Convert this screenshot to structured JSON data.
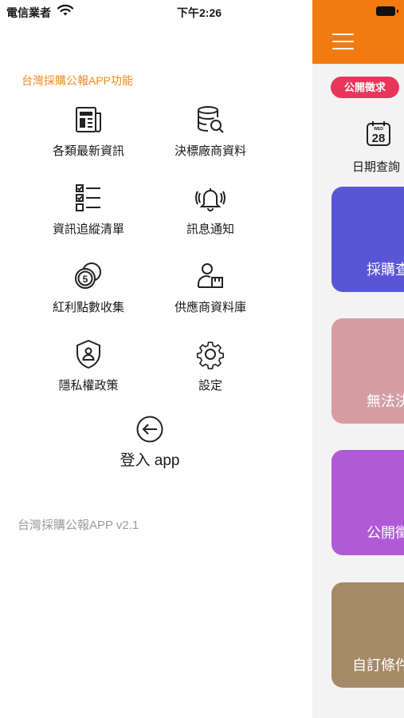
{
  "status_bar": {
    "carrier": "電信業者",
    "time": "下午2:26"
  },
  "drawer": {
    "title": "台灣採購公報APP功能",
    "items": [
      {
        "label": "各類最新資訊",
        "icon": "newspaper-icon"
      },
      {
        "label": "決標廠商資料",
        "icon": "database-search-icon"
      },
      {
        "label": "資訊追縱清單",
        "icon": "checklist-icon"
      },
      {
        "label": "訊息通知",
        "icon": "bell-ringing-icon"
      },
      {
        "label": "紅利點數收集",
        "icon": "coins-icon"
      },
      {
        "label": "供應商資料庫",
        "icon": "supplier-icon"
      },
      {
        "label": "隱私權政策",
        "icon": "shield-user-icon"
      },
      {
        "label": "設定",
        "icon": "gear-icon"
      }
    ],
    "login_label": "登入 app",
    "version": "台灣採購公報APP v2.1"
  },
  "main": {
    "chip_label": "公開徵求",
    "date_day": "28",
    "date_weekday": "WED",
    "date_label": "日期查詢",
    "cards": [
      {
        "label": "採購查",
        "color": "#5956d6"
      },
      {
        "label": "無法決",
        "color": "#d59da2"
      },
      {
        "label": "公開徵",
        "color": "#b05ad8"
      },
      {
        "label": "自訂條件",
        "color": "#a58a67"
      }
    ]
  },
  "colors": {
    "accent": "#f37a10",
    "title": "#f08a1c",
    "chip": "#e8365b"
  }
}
